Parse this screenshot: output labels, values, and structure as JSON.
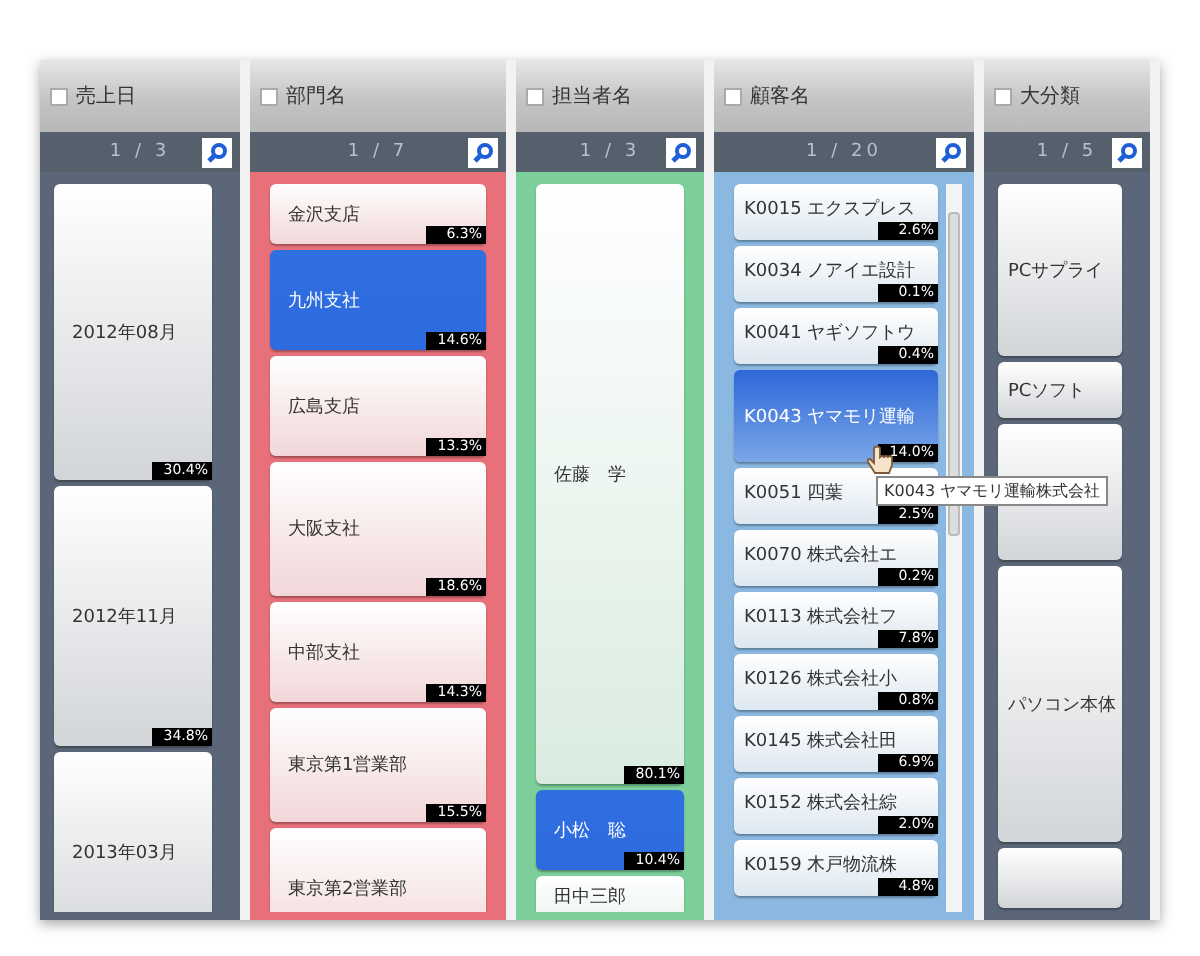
{
  "columns": [
    {
      "title": "売上日",
      "checked": false,
      "count": "1 / 3",
      "color": "#5b6778",
      "items": [
        {
          "label": "2012年08月",
          "share": "30.4%",
          "selected": false
        },
        {
          "label": "2012年11月",
          "share": "34.8%",
          "selected": false
        },
        {
          "label": "2013年03月",
          "selected": false
        }
      ]
    },
    {
      "title": "部門名",
      "checked": false,
      "count": "1 / 7",
      "color": "#e8707a",
      "items": [
        {
          "label": "金沢支店",
          "share": "6.3%",
          "selected": false
        },
        {
          "label": "九州支社",
          "share": "14.6%",
          "selected": true
        },
        {
          "label": "広島支店",
          "share": "13.3%",
          "selected": false
        },
        {
          "label": "大阪支社",
          "share": "18.6%",
          "selected": false
        },
        {
          "label": "中部支社",
          "share": "14.3%",
          "selected": false
        },
        {
          "label": "東京第1営業部",
          "share": "15.5%",
          "selected": false
        },
        {
          "label": "東京第2営業部",
          "selected": false
        }
      ]
    },
    {
      "title": "担当者名",
      "checked": false,
      "count": "1 / 3",
      "color": "#7ccf9a",
      "items": [
        {
          "label": "佐藤　学",
          "share": "80.1%",
          "selected": false
        },
        {
          "label": "小松　聡",
          "share": "10.4%",
          "selected": true
        },
        {
          "label": "田中三郎",
          "selected": false
        }
      ]
    },
    {
      "title": "顧客名",
      "checked": false,
      "count": "1 / 20",
      "color": "#8ab8e0",
      "items": [
        {
          "label": "K0015 エクスプレス",
          "share": "2.6%",
          "selected": false
        },
        {
          "label": "K0034 ノアイエ設計",
          "share": "0.1%",
          "selected": false
        },
        {
          "label": "K0041 ヤギソフトウ",
          "share": "0.4%",
          "selected": false
        },
        {
          "label": "K0043 ヤマモリ運輸",
          "share": "14.0%",
          "selected": true
        },
        {
          "label": "K0051 四葉",
          "share": "2.5%",
          "selected": false
        },
        {
          "label": "K0070 株式会社エ",
          "share": "0.2%",
          "selected": false
        },
        {
          "label": "K0113 株式会社フ",
          "share": "7.8%",
          "selected": false
        },
        {
          "label": "K0126 株式会社小",
          "share": "0.8%",
          "selected": false
        },
        {
          "label": "K0145 株式会社田",
          "share": "6.9%",
          "selected": false
        },
        {
          "label": "K0152 株式会社綜",
          "share": "2.0%",
          "selected": false
        },
        {
          "label": "K0159 木戸物流株",
          "share": "4.8%",
          "selected": false
        }
      ]
    },
    {
      "title": "大分類",
      "checked": false,
      "count": "1 / 5",
      "color": "#5b6778",
      "items": [
        {
          "label": "PCサプライ",
          "selected": false
        },
        {
          "label": "PCソフト",
          "selected": false
        },
        {
          "selected": false
        },
        {
          "label": "パソコン本体",
          "selected": false
        },
        {
          "selected": false
        }
      ]
    }
  ],
  "tooltip": "K0043 ヤマモリ運輸株式会社"
}
